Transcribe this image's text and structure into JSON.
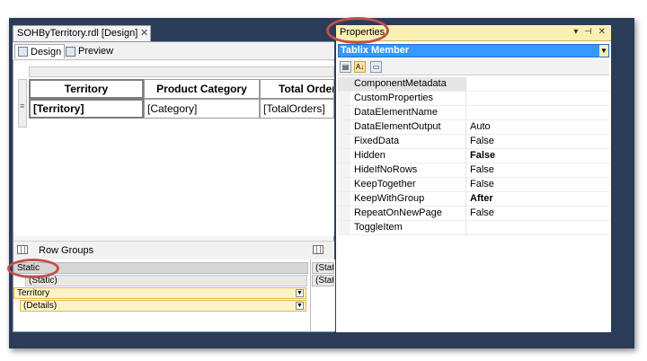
{
  "document_tab": {
    "title": "SOHByTerritory.rdl [Design]",
    "close": "✕"
  },
  "view_tabs": [
    {
      "label": "Design",
      "icon": "design-icon"
    },
    {
      "label": "Preview",
      "icon": "preview-icon"
    }
  ],
  "tablix": {
    "headers": [
      "Territory",
      "Product Category",
      "Total Orders"
    ],
    "details": [
      "[Territory]",
      "[Category]",
      "[TotalOrders]"
    ],
    "row_marker": "≡"
  },
  "row_groups": {
    "title": "Row Groups",
    "items": [
      "Static",
      "(Static)",
      "Territory",
      "(Details)"
    ]
  },
  "column_groups": {
    "items": [
      "(Static)",
      "(Static)"
    ]
  },
  "properties": {
    "title": "Properties",
    "window_buttons": "▾ ⊣ ✕",
    "object": "Tablix Member",
    "toolbar": {
      "categorized": "▤",
      "alphabetical": "A↓",
      "pages": "▭"
    },
    "rows": [
      {
        "name": "ComponentMetadata",
        "value": ""
      },
      {
        "name": "CustomProperties",
        "value": ""
      },
      {
        "name": "DataElementName",
        "value": ""
      },
      {
        "name": "DataElementOutput",
        "value": "Auto"
      },
      {
        "name": "FixedData",
        "value": "False"
      },
      {
        "name": "Hidden",
        "value": "False"
      },
      {
        "name": "HideIfNoRows",
        "value": "False"
      },
      {
        "name": "KeepTogether",
        "value": "False"
      },
      {
        "name": "KeepWithGroup",
        "value": "After"
      },
      {
        "name": "RepeatOnNewPage",
        "value": "False"
      },
      {
        "name": "ToggleItem",
        "value": ""
      }
    ]
  },
  "colors": {
    "frame": "#2b3c59",
    "properties_title": "#fbf0b4",
    "selection": "#3399ff",
    "callout": "#c0504d",
    "selected_group": "#fdf3c7"
  }
}
